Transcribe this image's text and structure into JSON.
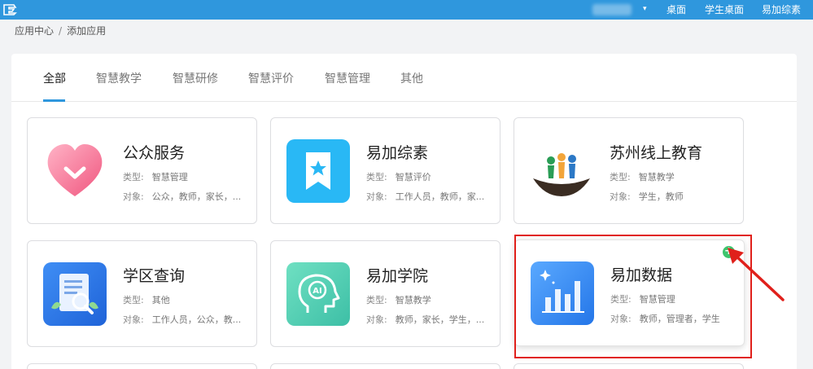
{
  "topbar": {
    "nav": [
      "桌面",
      "学生桌面",
      "易加综素"
    ],
    "bg_color": "#2f97dd"
  },
  "breadcrumb": {
    "items": [
      "应用中心",
      "添加应用"
    ],
    "separator": "/"
  },
  "tabs": [
    {
      "label": "全部",
      "active": true
    },
    {
      "label": "智慧教学",
      "active": false
    },
    {
      "label": "智慧研修",
      "active": false
    },
    {
      "label": "智慧评价",
      "active": false
    },
    {
      "label": "智慧管理",
      "active": false
    },
    {
      "label": "其他",
      "active": false
    }
  ],
  "cards": [
    {
      "title": "公众服务",
      "type_label": "类型:",
      "type": "智慧管理",
      "target_label": "对象:",
      "target": "公众，教师，家长，...",
      "icon": "heart-icon"
    },
    {
      "title": "易加综素",
      "type_label": "类型:",
      "type": "智慧评价",
      "target_label": "对象:",
      "target": "工作人员，教师，家...",
      "icon": "bookmark-star-icon"
    },
    {
      "title": "苏州线上教育",
      "type_label": "类型:",
      "type": "智慧教学",
      "target_label": "对象:",
      "target": "学生，教师",
      "icon": "boat-people-icon"
    },
    {
      "title": "学区查询",
      "type_label": "类型:",
      "type": "其他",
      "target_label": "对象:",
      "target": "工作人员，公众，教...",
      "icon": "document-search-icon"
    },
    {
      "title": "易加学院",
      "type_label": "类型:",
      "type": "智慧教学",
      "target_label": "对象:",
      "target": "教师，家长，学生，...",
      "icon": "ai-head-icon"
    },
    {
      "title": "易加数据",
      "type_label": "类型:",
      "type": "智慧管理",
      "target_label": "对象:",
      "target": "教师，管理者，学生",
      "icon": "bar-chart-icon",
      "add_button": "+"
    }
  ]
}
